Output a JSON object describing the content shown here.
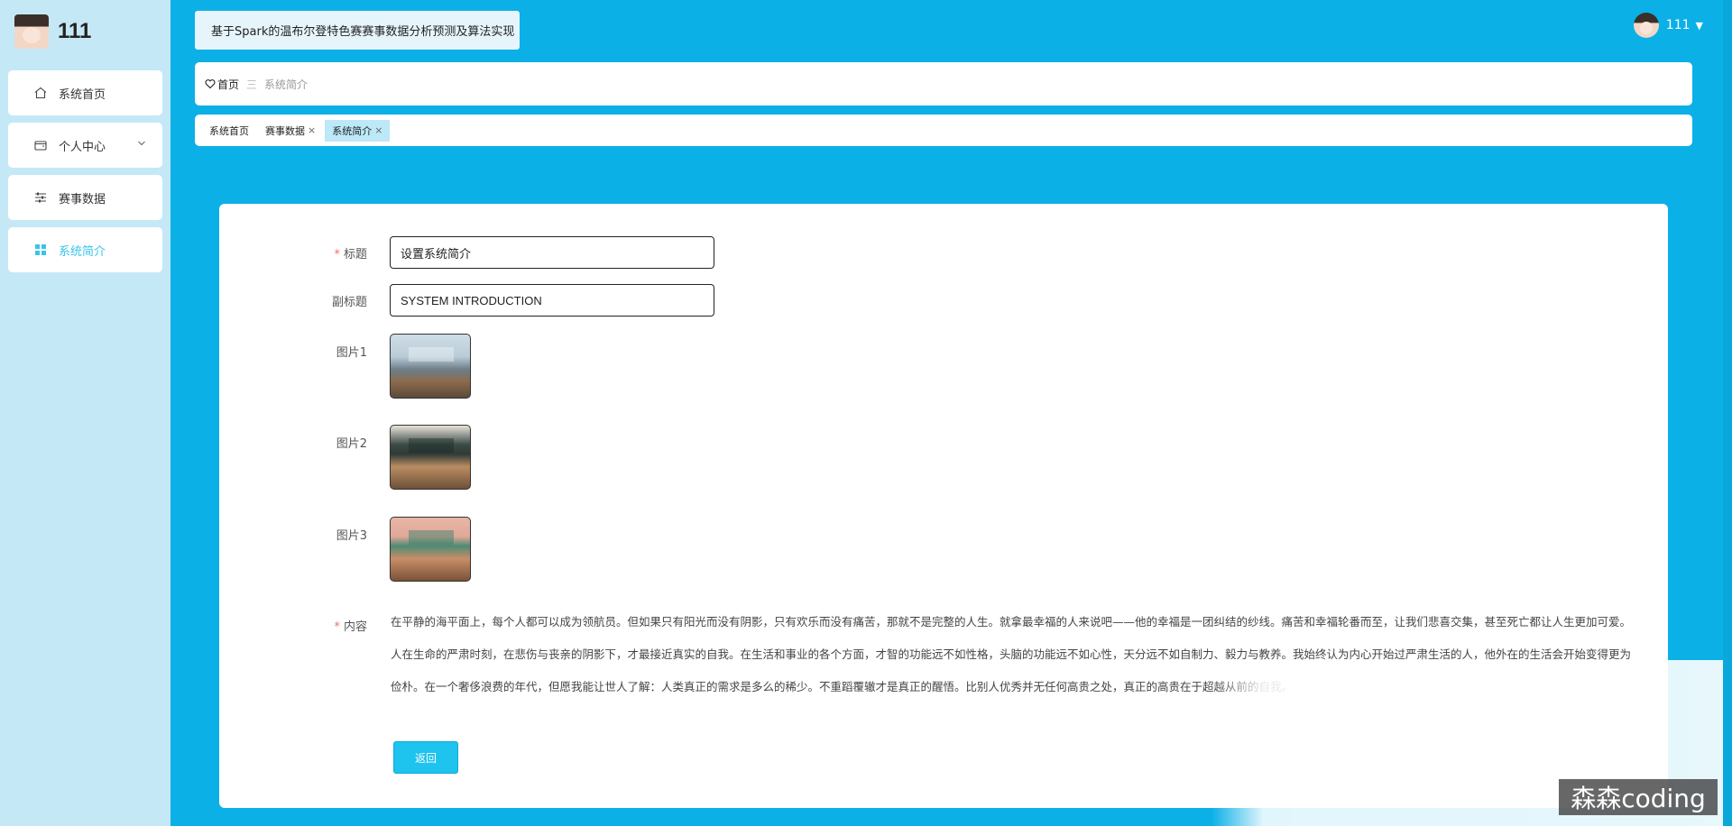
{
  "brand": {
    "name": "111"
  },
  "sidebar": {
    "items": [
      {
        "label": "系统首页",
        "icon": "home-icon"
      },
      {
        "label": "个人中心",
        "icon": "wallet-icon"
      },
      {
        "label": "赛事数据",
        "icon": "sliders-icon"
      },
      {
        "label": "系统简介",
        "icon": "grid-icon"
      }
    ]
  },
  "header": {
    "title": "基于Spark的温布尔登特色赛赛事数据分析预测及算法实现",
    "user_name": "111"
  },
  "breadcrumb": {
    "home": "首页",
    "current": "系统简介"
  },
  "tabs": [
    {
      "label": "系统首页"
    },
    {
      "label": "赛事数据"
    },
    {
      "label": "系统简介"
    }
  ],
  "form": {
    "title_label": "标题",
    "title_value": "设置系统简介",
    "subtitle_label": "副标题",
    "subtitle_value": "SYSTEM INTRODUCTION",
    "image1_label": "图片1",
    "image2_label": "图片2",
    "image3_label": "图片3",
    "content_label": "内容",
    "content_line1": "在平静的海平面上，每个人都可以成为领航员。但如果只有阳光而没有阴影，只有欢乐而没有痛苦，那就不是完整的人生。就拿最幸福的人来说吧——他的幸福是一团纠结的纱线。痛苦和幸福轮番而至，让我们悲喜交集，甚至死亡都让人生更加可爱。",
    "content_line2": "人在生命的严肃时刻，在悲伤与丧亲的阴影下，才最接近真实的自我。在生活和事业的各个方面，才智的功能远不如性格，头脑的功能远不如心性，天分远不如自制力、毅力与教养。我始终认为内心开始过严肃生活的人，他外在的生活会开始变得更为",
    "content_line3": "俭朴。在一个奢侈浪费的年代，但愿我能让世人了解：人类真正的需求是多么的稀少。不重蹈覆辙才是真正的醒悟。比别人优秀并无任何高贵之处，真正的高贵在于超越从前的自我。",
    "back_label": "返回"
  },
  "watermark": "森森coding",
  "colors": {
    "accent": "#0bb0e6",
    "active": "#38c5ea",
    "required": "#f56c6c"
  }
}
